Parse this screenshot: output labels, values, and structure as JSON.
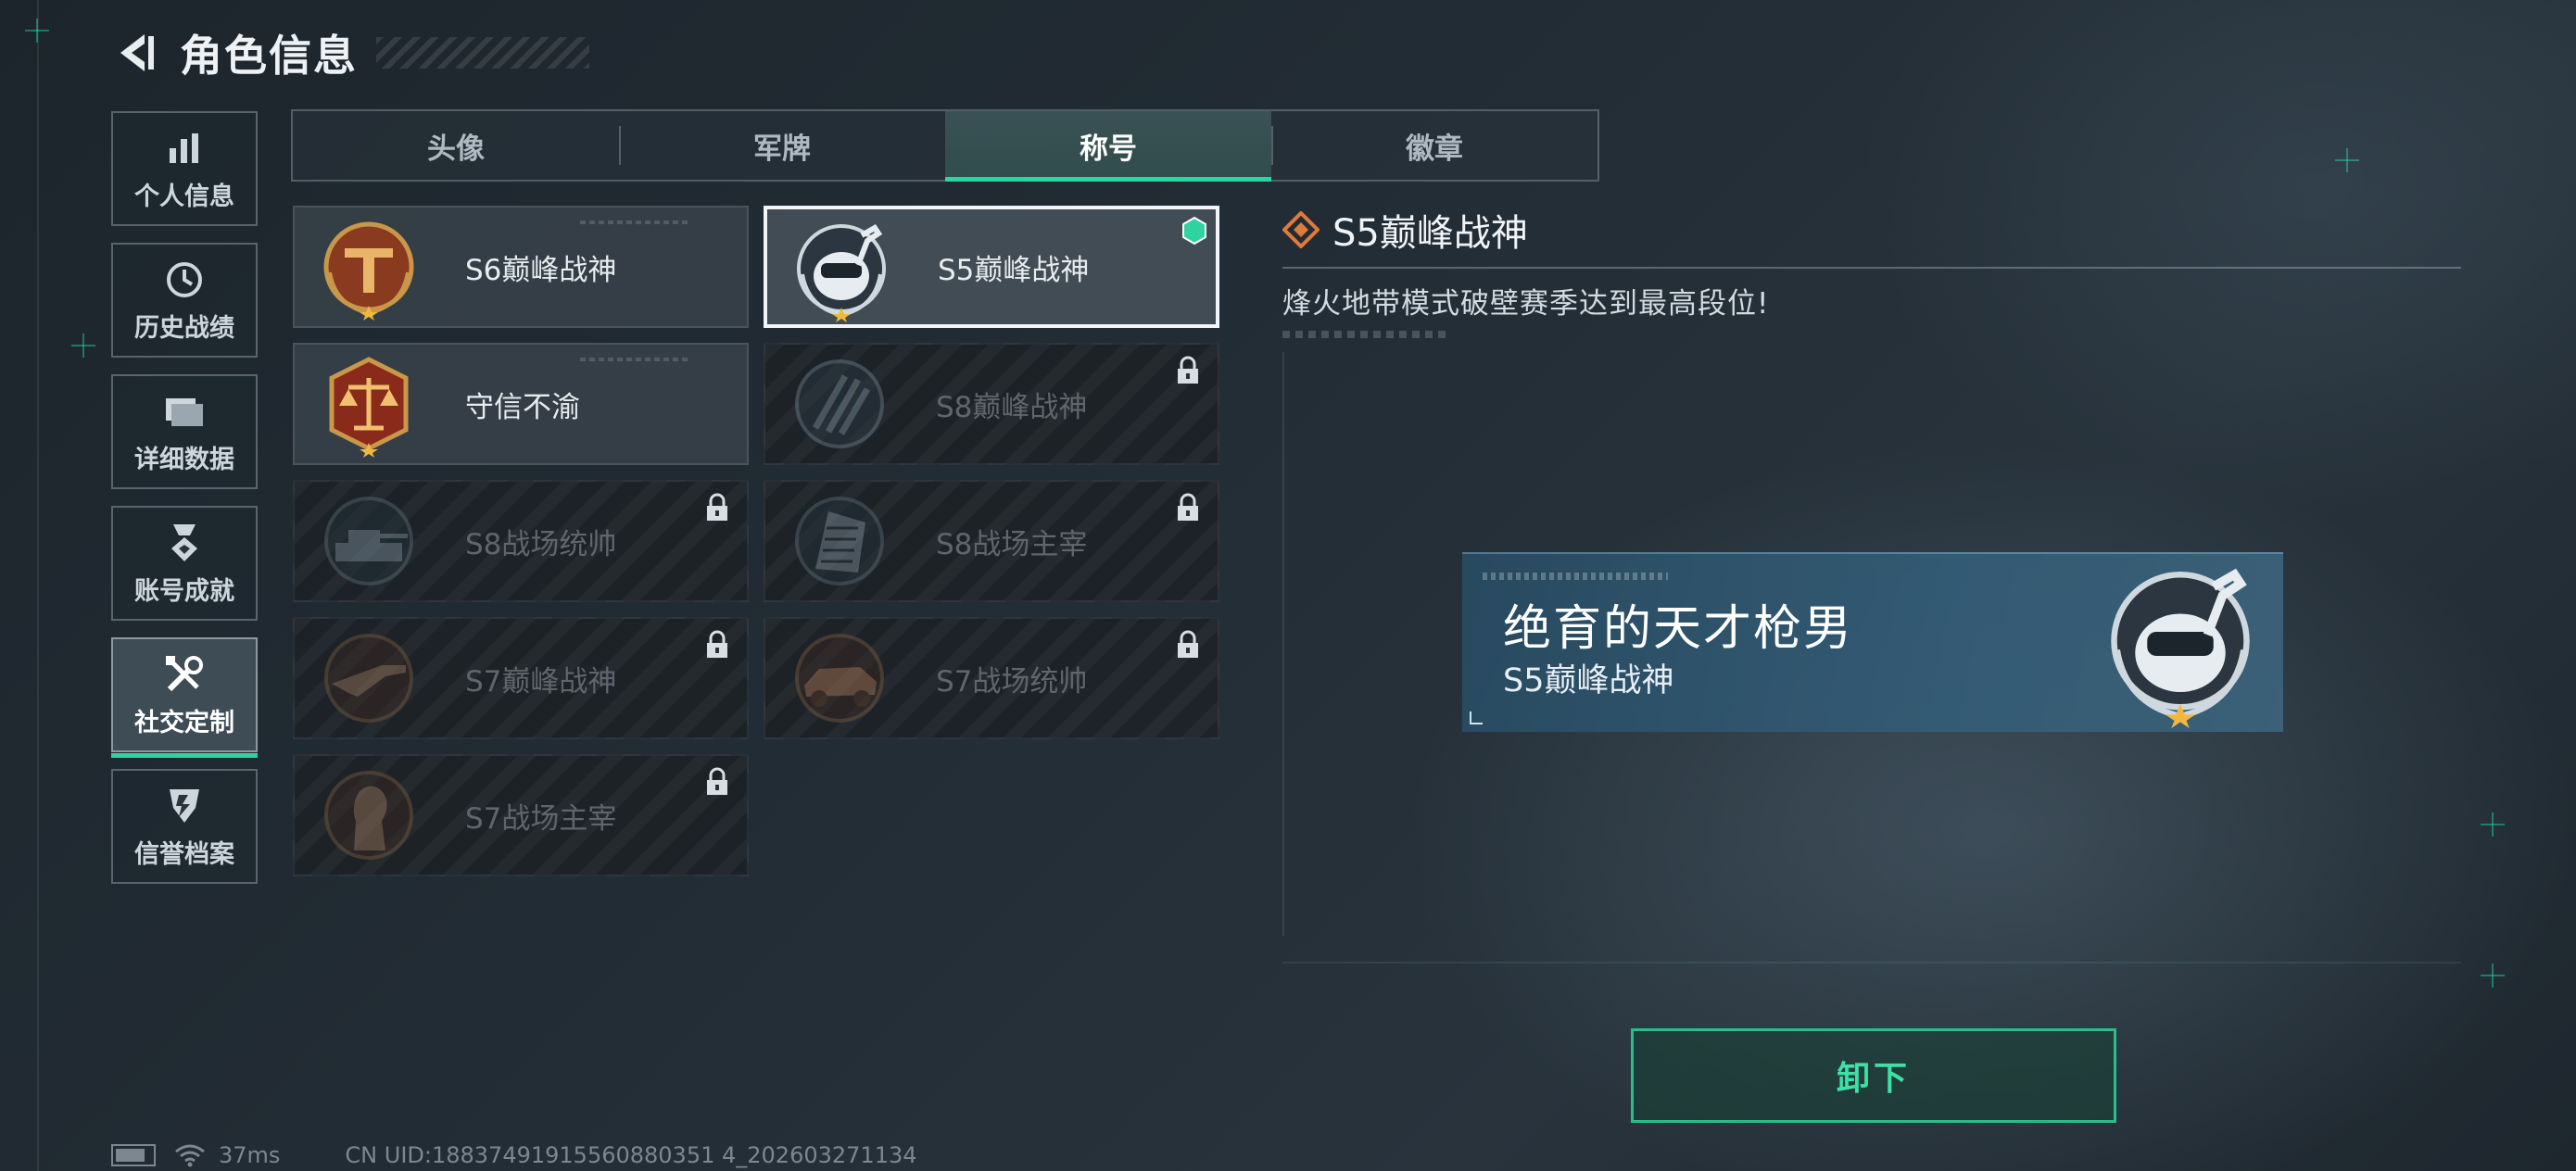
{
  "header": {
    "title": "角色信息",
    "back_icon": "back-arrow-icon"
  },
  "sidebar": {
    "items": [
      {
        "label": "个人信息",
        "icon": "bar-chart-icon",
        "active": false
      },
      {
        "label": "历史战绩",
        "icon": "history-clock-icon",
        "active": false
      },
      {
        "label": "详细数据",
        "icon": "folder-icon",
        "active": false
      },
      {
        "label": "账号成就",
        "icon": "medal-icon",
        "active": false
      },
      {
        "label": "社交定制",
        "icon": "tools-icon",
        "active": true
      },
      {
        "label": "信誉档案",
        "icon": "shield-icon",
        "active": false
      }
    ]
  },
  "tabs": [
    {
      "label": "头像",
      "active": false
    },
    {
      "label": "军牌",
      "active": false
    },
    {
      "label": "称号",
      "active": true
    },
    {
      "label": "徽章",
      "active": false
    }
  ],
  "titles": [
    {
      "name": "S6巅峰战神",
      "badge": "s6-peak-badge-icon",
      "locked": false,
      "equipped": false,
      "selected": false
    },
    {
      "name": "S5巅峰战神",
      "badge": "s5-peak-badge-icon",
      "locked": false,
      "equipped": true,
      "selected": true
    },
    {
      "name": "守信不渝",
      "badge": "scales-badge-icon",
      "locked": false,
      "equipped": false,
      "selected": false
    },
    {
      "name": "S8巅峰战神",
      "badge": "s8-peak-badge-icon",
      "locked": true,
      "equipped": false,
      "selected": false
    },
    {
      "name": "S8战场统帅",
      "badge": "tank-badge-icon",
      "locked": true,
      "equipped": false,
      "selected": false
    },
    {
      "name": "S8战场主宰",
      "badge": "building-badge-icon",
      "locked": true,
      "equipped": false,
      "selected": false
    },
    {
      "name": "S7巅峰战神",
      "badge": "rifle-badge-icon",
      "locked": true,
      "equipped": false,
      "selected": false
    },
    {
      "name": "S7战场统帅",
      "badge": "vehicle-badge-icon",
      "locked": true,
      "equipped": false,
      "selected": false
    },
    {
      "name": "S7战场主宰",
      "badge": "soldier-badge-icon",
      "locked": true,
      "equipped": false,
      "selected": false
    }
  ],
  "detail": {
    "title": "S5巅峰战神",
    "description": "烽火地带模式破壁赛季达到最高段位!",
    "icon": "diamond-rank-icon"
  },
  "preview": {
    "player_name": "绝育的天才枪男",
    "title": "S5巅峰战神",
    "badge": "s5-peak-badge-icon"
  },
  "actions": {
    "unequip_label": "卸下"
  },
  "status": {
    "ping": "37ms",
    "uid": "CN UID:18837491915560880351 4_202603271134"
  },
  "colors": {
    "accent": "#2fd3a0",
    "background": "#222c34",
    "button_text": "#3ee0a6",
    "detail_icon": "#e07a3a"
  }
}
